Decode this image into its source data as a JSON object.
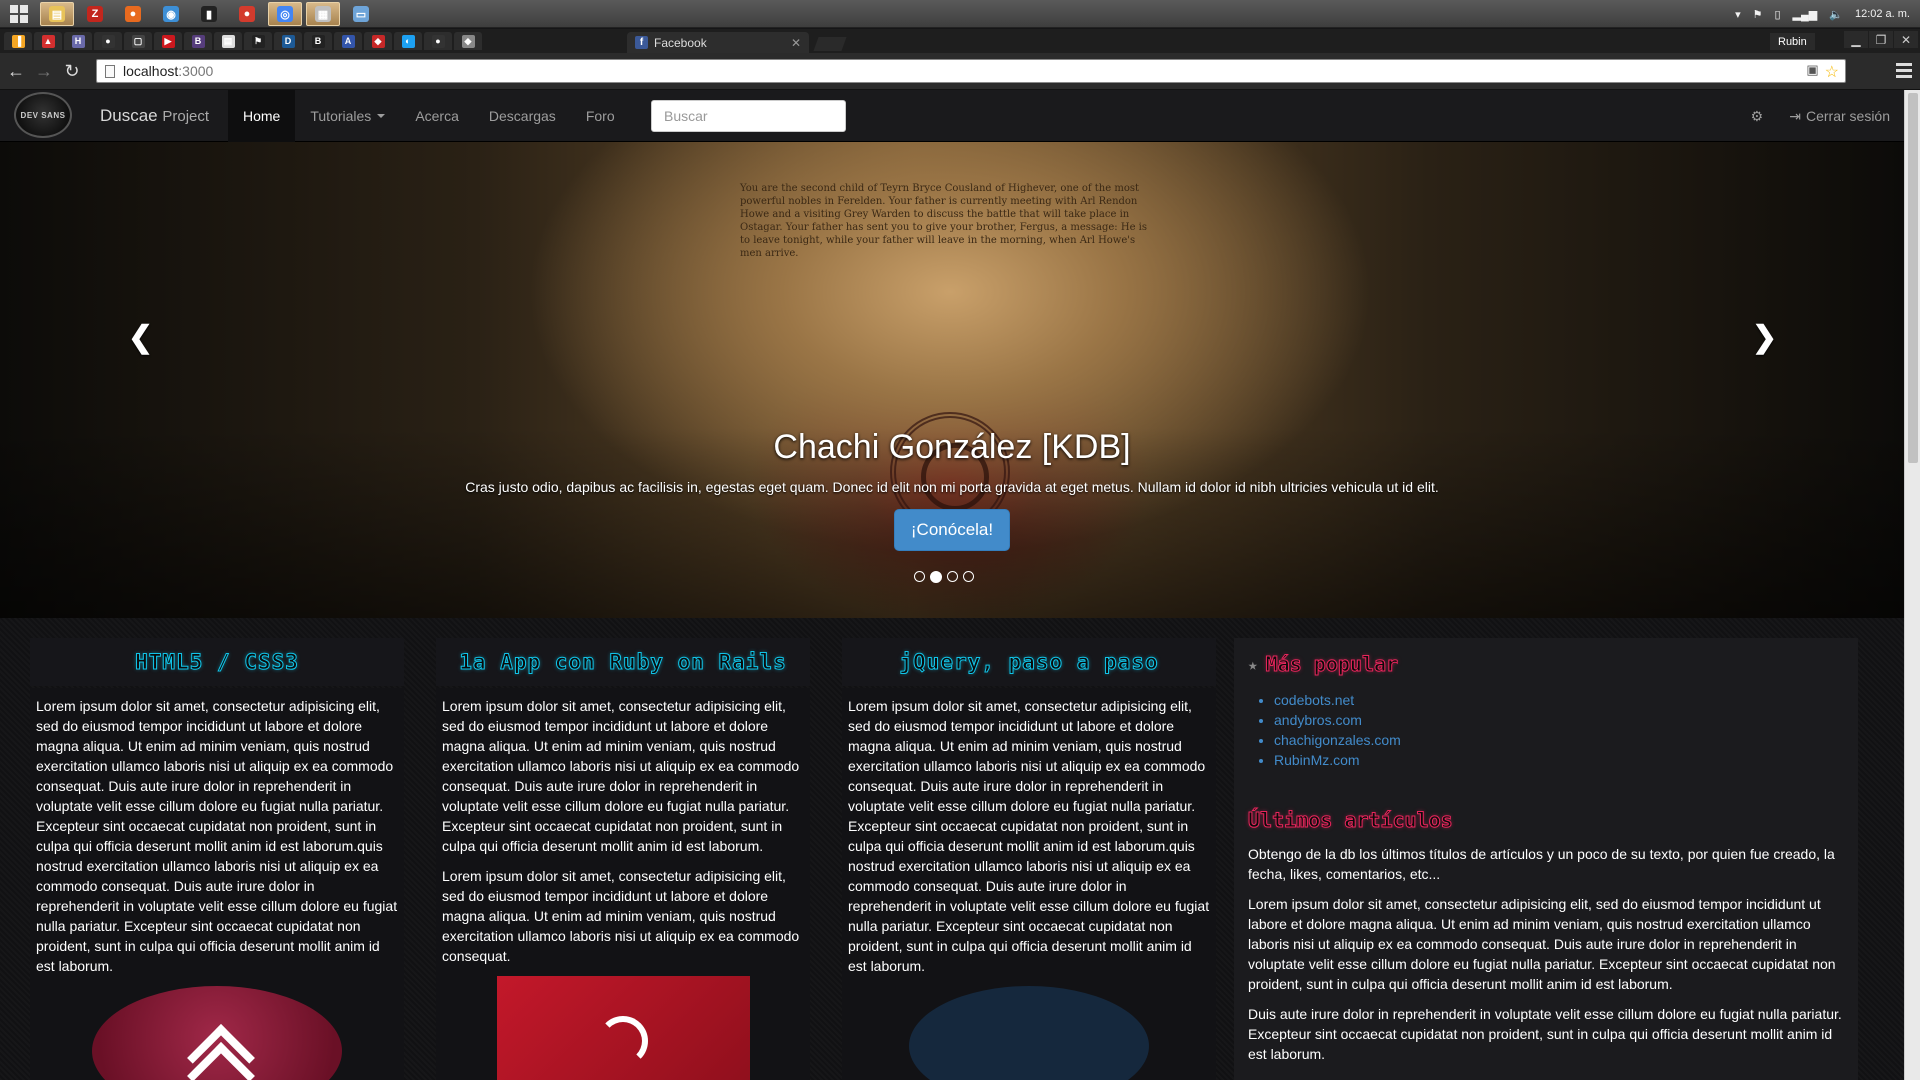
{
  "taskbar": {
    "apps": [
      {
        "icon": "file-explorer-icon",
        "glyph": "▤",
        "color": "#e8c35a",
        "active": true
      },
      {
        "icon": "filezilla-icon",
        "glyph": "Z",
        "color": "#c2261d",
        "active": false
      },
      {
        "icon": "firefox-icon",
        "glyph": "●",
        "color": "#e86a1f",
        "active": false
      },
      {
        "icon": "app-icon",
        "glyph": "◉",
        "color": "#3d8fd6",
        "active": false
      },
      {
        "icon": "terminal-icon",
        "glyph": "▮",
        "color": "#222222",
        "active": false
      },
      {
        "icon": "record-icon",
        "glyph": "●",
        "color": "#d33b2d",
        "active": false
      },
      {
        "icon": "chrome-icon",
        "glyph": "◎",
        "color": "#4285f4",
        "active": true
      },
      {
        "icon": "notepad-icon",
        "glyph": "▦",
        "color": "#bfbfbf",
        "active": true
      },
      {
        "icon": "window-icon",
        "glyph": "▭",
        "color": "#6ea4d8",
        "active": false
      }
    ],
    "clock": "12:02 a. m."
  },
  "browser": {
    "pinned_tabs": [
      {
        "icon": "bookmark-icon",
        "glyph": "▐",
        "color": "#f5a623"
      },
      {
        "icon": "app-icon",
        "glyph": "▲",
        "color": "#d32f2f"
      },
      {
        "icon": "hootsuite-icon",
        "glyph": "H",
        "color": "#6a6aaa"
      },
      {
        "icon": "github-icon",
        "glyph": "●",
        "color": "#333333"
      },
      {
        "icon": "box-icon",
        "glyph": "▢",
        "color": "#444444"
      },
      {
        "icon": "youtube-icon",
        "glyph": "▶",
        "color": "#cc181e"
      },
      {
        "icon": "bootstrap-icon",
        "glyph": "B",
        "color": "#563d7c"
      },
      {
        "icon": "document-icon",
        "glyph": "▤",
        "color": "#dddddd"
      },
      {
        "icon": "flag-icon",
        "glyph": "⚑",
        "color": "#222222"
      },
      {
        "icon": "devtools-icon",
        "glyph": "D",
        "color": "#1d5a96"
      },
      {
        "icon": "bootstrap-icon",
        "glyph": "B",
        "color": "#222222"
      },
      {
        "icon": "translate-icon",
        "glyph": "A",
        "color": "#3355aa"
      },
      {
        "icon": "app-icon",
        "glyph": "◆",
        "color": "#c62828"
      },
      {
        "icon": "app-icon",
        "glyph": "◐",
        "color": "#1da1f2"
      },
      {
        "icon": "github-icon",
        "glyph": "●",
        "color": "#333333"
      },
      {
        "icon": "gem-icon",
        "glyph": "◆",
        "color": "#888888"
      }
    ],
    "active_tab": {
      "title": "Facebook",
      "icon": "facebook-icon"
    },
    "profile": "Rubin",
    "url_host": "localhost",
    "url_port": ":3000"
  },
  "site": {
    "brand": "Duscae",
    "brand_sub": "Project",
    "logo_text": "DEV SANS",
    "menu": [
      {
        "label": "Home",
        "active": true
      },
      {
        "label": "Tutoriales",
        "dropdown": true
      },
      {
        "label": "Acerca"
      },
      {
        "label": "Descargas"
      },
      {
        "label": "Foro"
      }
    ],
    "search_placeholder": "Buscar",
    "logout": "Cerrar sesión"
  },
  "carousel": {
    "parchment_text": "You are the second child of Teyrn Bryce Cousland of Highever, one of the most powerful nobles in Ferelden. Your father is currently meeting with Arl Rendon Howe and a visiting Grey Warden to discuss the battle that will take place in Ostagar. Your father has sent you to give your brother, Fergus, a message: He is to leave tonight, while your father will leave in the morning, when Arl Howe's men arrive.",
    "title": "Chachi González [KDB]",
    "text": "Cras justo odio, dapibus ac facilisis in, egestas eget quam. Donec id elit non mi porta gravida at eget metus. Nullam id dolor id nibh ultricies vehicula ut id elit.",
    "button": "¡Conócela!",
    "slides": 4,
    "active_slide": 1
  },
  "columns": [
    {
      "title": "HTML5 / CSS3",
      "paragraphs": [
        "Lorem ipsum dolor sit amet, consectetur adipisicing elit, sed do eiusmod tempor incididunt ut labore et dolore magna aliqua. Ut enim ad minim veniam, quis nostrud exercitation ullamco laboris nisi ut aliquip ex ea commodo consequat. Duis aute irure dolor in reprehenderit in voluptate velit esse cillum dolore eu fugiat nulla pariatur. Excepteur sint occaecat cupidatat non proident, sunt in culpa qui officia deserunt mollit anim id est laborum.quis nostrud exercitation ullamco laboris nisi ut aliquip ex ea commodo consequat. Duis aute irure dolor in reprehenderit in voluptate velit esse cillum dolore eu fugiat nulla pariatur. Excepteur sint occaecat cupidatat non proident, sunt in culpa qui officia deserunt mollit anim id est laborum."
      ]
    },
    {
      "title": "1a App con Ruby on Rails",
      "paragraphs": [
        "Lorem ipsum dolor sit amet, consectetur adipisicing elit, sed do eiusmod tempor incididunt ut labore et dolore magna aliqua. Ut enim ad minim veniam, quis nostrud exercitation ullamco laboris nisi ut aliquip ex ea commodo consequat. Duis aute irure dolor in reprehenderit in voluptate velit esse cillum dolore eu fugiat nulla pariatur. Excepteur sint occaecat cupidatat non proident, sunt in culpa qui officia deserunt mollit anim id est laborum.",
        "Lorem ipsum dolor sit amet, consectetur adipisicing elit, sed do eiusmod tempor incididunt ut labore et dolore magna aliqua. Ut enim ad minim veniam, quis nostrud exercitation ullamco laboris nisi ut aliquip ex ea commodo consequat."
      ]
    },
    {
      "title": "jQuery, paso a paso",
      "paragraphs": [
        "Lorem ipsum dolor sit amet, consectetur adipisicing elit, sed do eiusmod tempor incididunt ut labore et dolore magna aliqua. Ut enim ad minim veniam, quis nostrud exercitation ullamco laboris nisi ut aliquip ex ea commodo consequat. Duis aute irure dolor in reprehenderit in voluptate velit esse cillum dolore eu fugiat nulla pariatur. Excepteur sint occaecat cupidatat non proident, sunt in culpa qui officia deserunt mollit anim id est laborum.quis nostrud exercitation ullamco laboris nisi ut aliquip ex ea commodo consequat. Duis aute irure dolor in reprehenderit in voluptate velit esse cillum dolore eu fugiat nulla pariatur. Excepteur sint occaecat cupidatat non proident, sunt in culpa qui officia deserunt mollit anim id est laborum."
      ]
    }
  ],
  "sidebar": {
    "popular_title": "Más popular",
    "popular_links": [
      "codebots.net",
      "andybros.com",
      "chachigonzales.com",
      "RubinMz.com"
    ],
    "latest_title": "Últimos artículos",
    "latest_paragraphs": [
      "Obtengo de la db los últimos títulos de artículos y un poco de su texto, por quien fue creado, la fecha, likes, comentarios, etc...",
      "Lorem ipsum dolor sit amet, consectetur adipisicing elit, sed do eiusmod tempor incididunt ut labore et dolore magna aliqua. Ut enim ad minim veniam, quis nostrud exercitation ullamco laboris nisi ut aliquip ex ea commodo consequat. Duis aute irure dolor in reprehenderit in voluptate velit esse cillum dolore eu fugiat nulla pariatur. Excepteur sint occaecat cupidatat non proident, sunt in culpa qui officia deserunt mollit anim id est laborum.",
      "Duis aute irure dolor in reprehenderit in voluptate velit esse cillum dolore eu fugiat nulla pariatur. Excepteur sint occaecat cupidatat non proident, sunt in culpa qui officia deserunt mollit anim id est laborum."
    ]
  },
  "colors": {
    "accent_cyan": "#11c4e8",
    "accent_pink": "#e8255c",
    "link_blue": "#428bca"
  }
}
